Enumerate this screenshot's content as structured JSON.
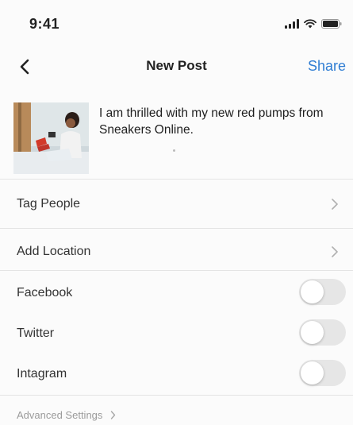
{
  "status_bar": {
    "time": "9:41",
    "icons": [
      "signal-icon",
      "wifi-icon",
      "battery-icon"
    ]
  },
  "nav": {
    "back_icon": "chevron-left-icon",
    "title": "New Post",
    "share_label": "Share"
  },
  "post": {
    "thumbnail": "photo of a woman holding a phone and red shoes",
    "caption": "I am thrilled with my new red pumps from Sneakers Online."
  },
  "options": [
    {
      "label": "Tag People",
      "control": "chevron"
    },
    {
      "label": "Add Location",
      "control": "chevron"
    }
  ],
  "share_to": [
    {
      "label": "Facebook",
      "enabled": false
    },
    {
      "label": "Twitter",
      "enabled": false
    },
    {
      "label": "Intagram",
      "enabled": false
    }
  ],
  "advanced": {
    "label": "Advanced Settings",
    "icon": "chevron-right-icon"
  },
  "colors": {
    "accent": "#2f7dd3",
    "toggle_off": "#e6e6e6",
    "divider": "#e4e4e4"
  }
}
